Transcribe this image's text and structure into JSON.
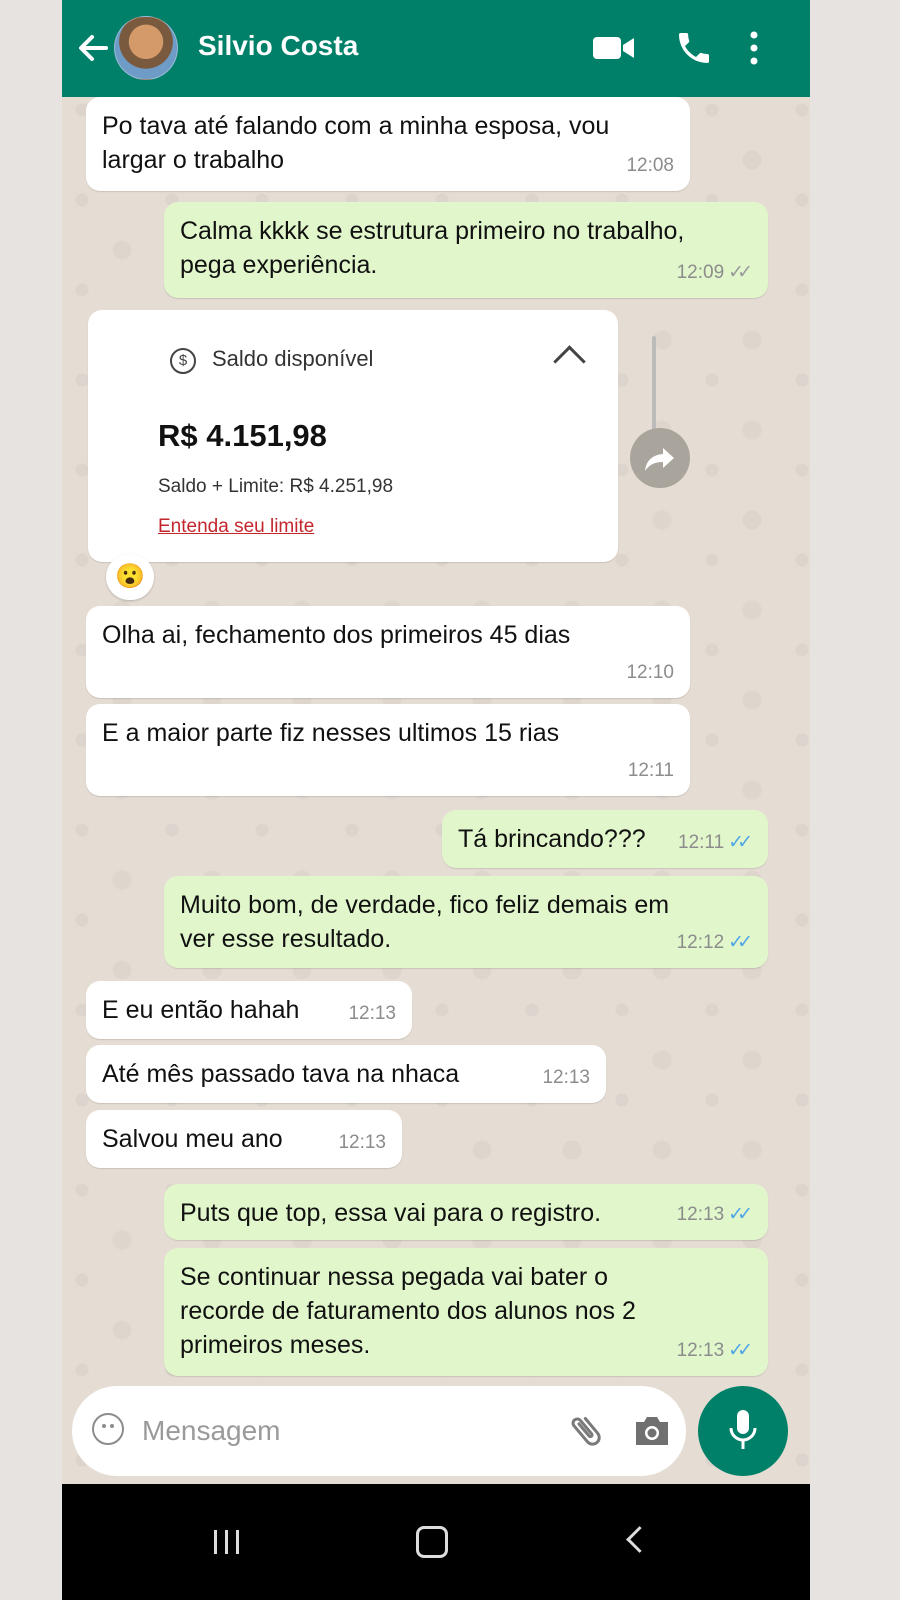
{
  "header": {
    "contact_name": "Silvio Costa"
  },
  "messages": [
    {
      "direction": "in",
      "text_lines": [
        "Po tava até falando com a minha esposa, vou",
        "largar o trabalho"
      ],
      "time": "12:08"
    },
    {
      "direction": "out",
      "text_lines": [
        "Calma kkkk se estrutura primeiro no trabalho,",
        "pega experiência."
      ],
      "time": "12:09",
      "status": "delivered"
    },
    {
      "direction": "in",
      "text_lines": [
        "Olha ai, fechamento dos primeiros 45 dias"
      ],
      "time": "12:10"
    },
    {
      "direction": "in",
      "text_lines": [
        "E a maior parte fiz nesses ultimos 15 rias"
      ],
      "time": "12:11"
    },
    {
      "direction": "out",
      "text_lines": [
        "Tá brincando???"
      ],
      "time": "12:11",
      "status": "read"
    },
    {
      "direction": "out",
      "text_lines": [
        "Muito bom, de verdade, fico feliz demais em",
        "ver esse resultado."
      ],
      "time": "12:12",
      "status": "read"
    },
    {
      "direction": "in",
      "text_lines": [
        "E eu então hahah"
      ],
      "time": "12:13"
    },
    {
      "direction": "in",
      "text_lines": [
        "Até mês passado tava na nhaca"
      ],
      "time": "12:13"
    },
    {
      "direction": "in",
      "text_lines": [
        "Salvou meu ano"
      ],
      "time": "12:13"
    },
    {
      "direction": "out",
      "text_lines": [
        "Puts que top, essa vai para o registro."
      ],
      "time": "12:13",
      "status": "read"
    },
    {
      "direction": "out",
      "text_lines": [
        "Se continuar nessa pegada vai bater o",
        "recorde de faturamento dos alunos nos 2",
        "primeiros meses."
      ],
      "time": "12:13",
      "status": "read"
    }
  ],
  "balance_card": {
    "label": "Saldo disponível",
    "amount": "R$  4.151,98",
    "limit": "Saldo + Limite: R$  4.251,98",
    "link": "Entenda seu limite",
    "currency_symbol": "$"
  },
  "reaction": {
    "emoji": "😮"
  },
  "composer": {
    "placeholder": "Mensagem"
  },
  "ticks": {
    "double": "✓✓"
  },
  "colors": {
    "header": "#008069",
    "incoming_bubble": "#ffffff",
    "outgoing_bubble": "#e1f7cb",
    "read_tick": "#4fa6e6",
    "delivered_tick": "#9a9a9a",
    "link_red": "#c4262e"
  }
}
